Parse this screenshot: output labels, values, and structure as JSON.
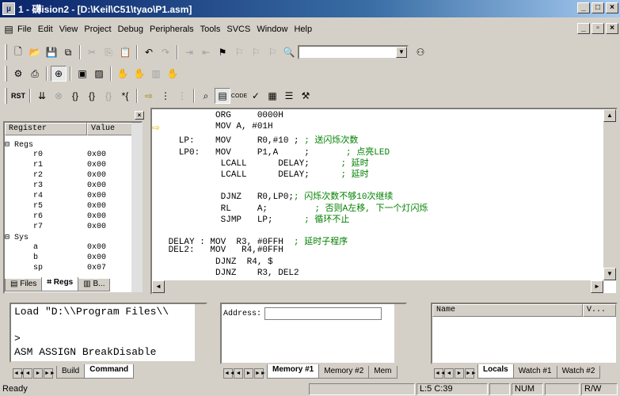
{
  "window": {
    "title": "1 - 礴ision2 - [D:\\Keil\\C51\\tyao\\P1.asm]",
    "buttons": [
      "_",
      "□",
      "×"
    ]
  },
  "menu": {
    "items": [
      "File",
      "Edit",
      "View",
      "Project",
      "Debug",
      "Peripherals",
      "Tools",
      "SVCS",
      "Window",
      "Help"
    ],
    "mdi_buttons": [
      "_",
      "▫",
      "×"
    ]
  },
  "registers": {
    "col_register": "Register",
    "col_value": "Value",
    "rows": [
      {
        "name": "⊟ Regs",
        "value": ""
      },
      {
        "name": "      r0",
        "value": "0x00"
      },
      {
        "name": "      r1",
        "value": "0x00"
      },
      {
        "name": "      r2",
        "value": "0x00"
      },
      {
        "name": "      r3",
        "value": "0x00"
      },
      {
        "name": "      r4",
        "value": "0x00"
      },
      {
        "name": "      r5",
        "value": "0x00"
      },
      {
        "name": "      r6",
        "value": "0x00"
      },
      {
        "name": "      r7",
        "value": "0x00"
      },
      {
        "name": "⊟ Sys",
        "value": ""
      },
      {
        "name": "      a",
        "value": "0x00"
      },
      {
        "name": "      b",
        "value": "0x00"
      },
      {
        "name": "      sp",
        "value": "0x07"
      }
    ],
    "tabs": [
      "Files",
      "Regs",
      "B..."
    ]
  },
  "code": {
    "lines": [
      {
        "code": "          ORG     0000H",
        "comment": ""
      },
      {
        "code": "          MOV A, #01H",
        "comment": ""
      },
      {
        "code": "   LP:    MOV     R0,#10 ; ",
        "comment": "; 送闪烁次数"
      },
      {
        "code": "   LP0:   MOV     P1,A     ;       ",
        "comment": "; 点亮LED"
      },
      {
        "code": "           LCALL      DELAY;      ",
        "comment": "; 延时"
      },
      {
        "code": "           LCALL      DELAY;      ",
        "comment": "; 延时"
      },
      {
        "code": "",
        "comment": ""
      },
      {
        "code": "           DJNZ   R0,LP0;",
        "comment": "; 闪烁次数不够10次继续"
      },
      {
        "code": "           RL     A;         ",
        "comment": "; 否则A左移, 下一个灯闪烁"
      },
      {
        "code": "           SJMP   LP;      ",
        "comment": "; 循环不止"
      },
      {
        "code": "",
        "comment": ""
      },
      {
        "code": " DELAY : MOV  R3, #0FFH  ",
        "comment": "; 延时子程序"
      },
      {
        "code": " DEL2:   MOV   R4,#0FFH",
        "comment": ""
      },
      {
        "code": "          DJNZ  R4, $",
        "comment": ""
      },
      {
        "code": "          DJNZ    R3, DEL2",
        "comment": ""
      }
    ]
  },
  "output": {
    "lines": [
      "Load \"D:\\\\Program Files\\\\",
      "",
      "> ",
      "ASM ASSIGN BreakDisable"
    ],
    "tabs": [
      "Build",
      "Command"
    ]
  },
  "memory": {
    "address_label": "Address:",
    "address_value": "",
    "tabs": [
      "Memory #1",
      "Memory #2",
      "Mem"
    ]
  },
  "locals": {
    "col_name": "Name",
    "col_value": "V...",
    "tabs": [
      "Locals",
      "Watch #1",
      "Watch #2"
    ]
  },
  "status": {
    "ready": "Ready",
    "position": "L:5 C:39",
    "num": "NUM",
    "rw": "R/W"
  }
}
